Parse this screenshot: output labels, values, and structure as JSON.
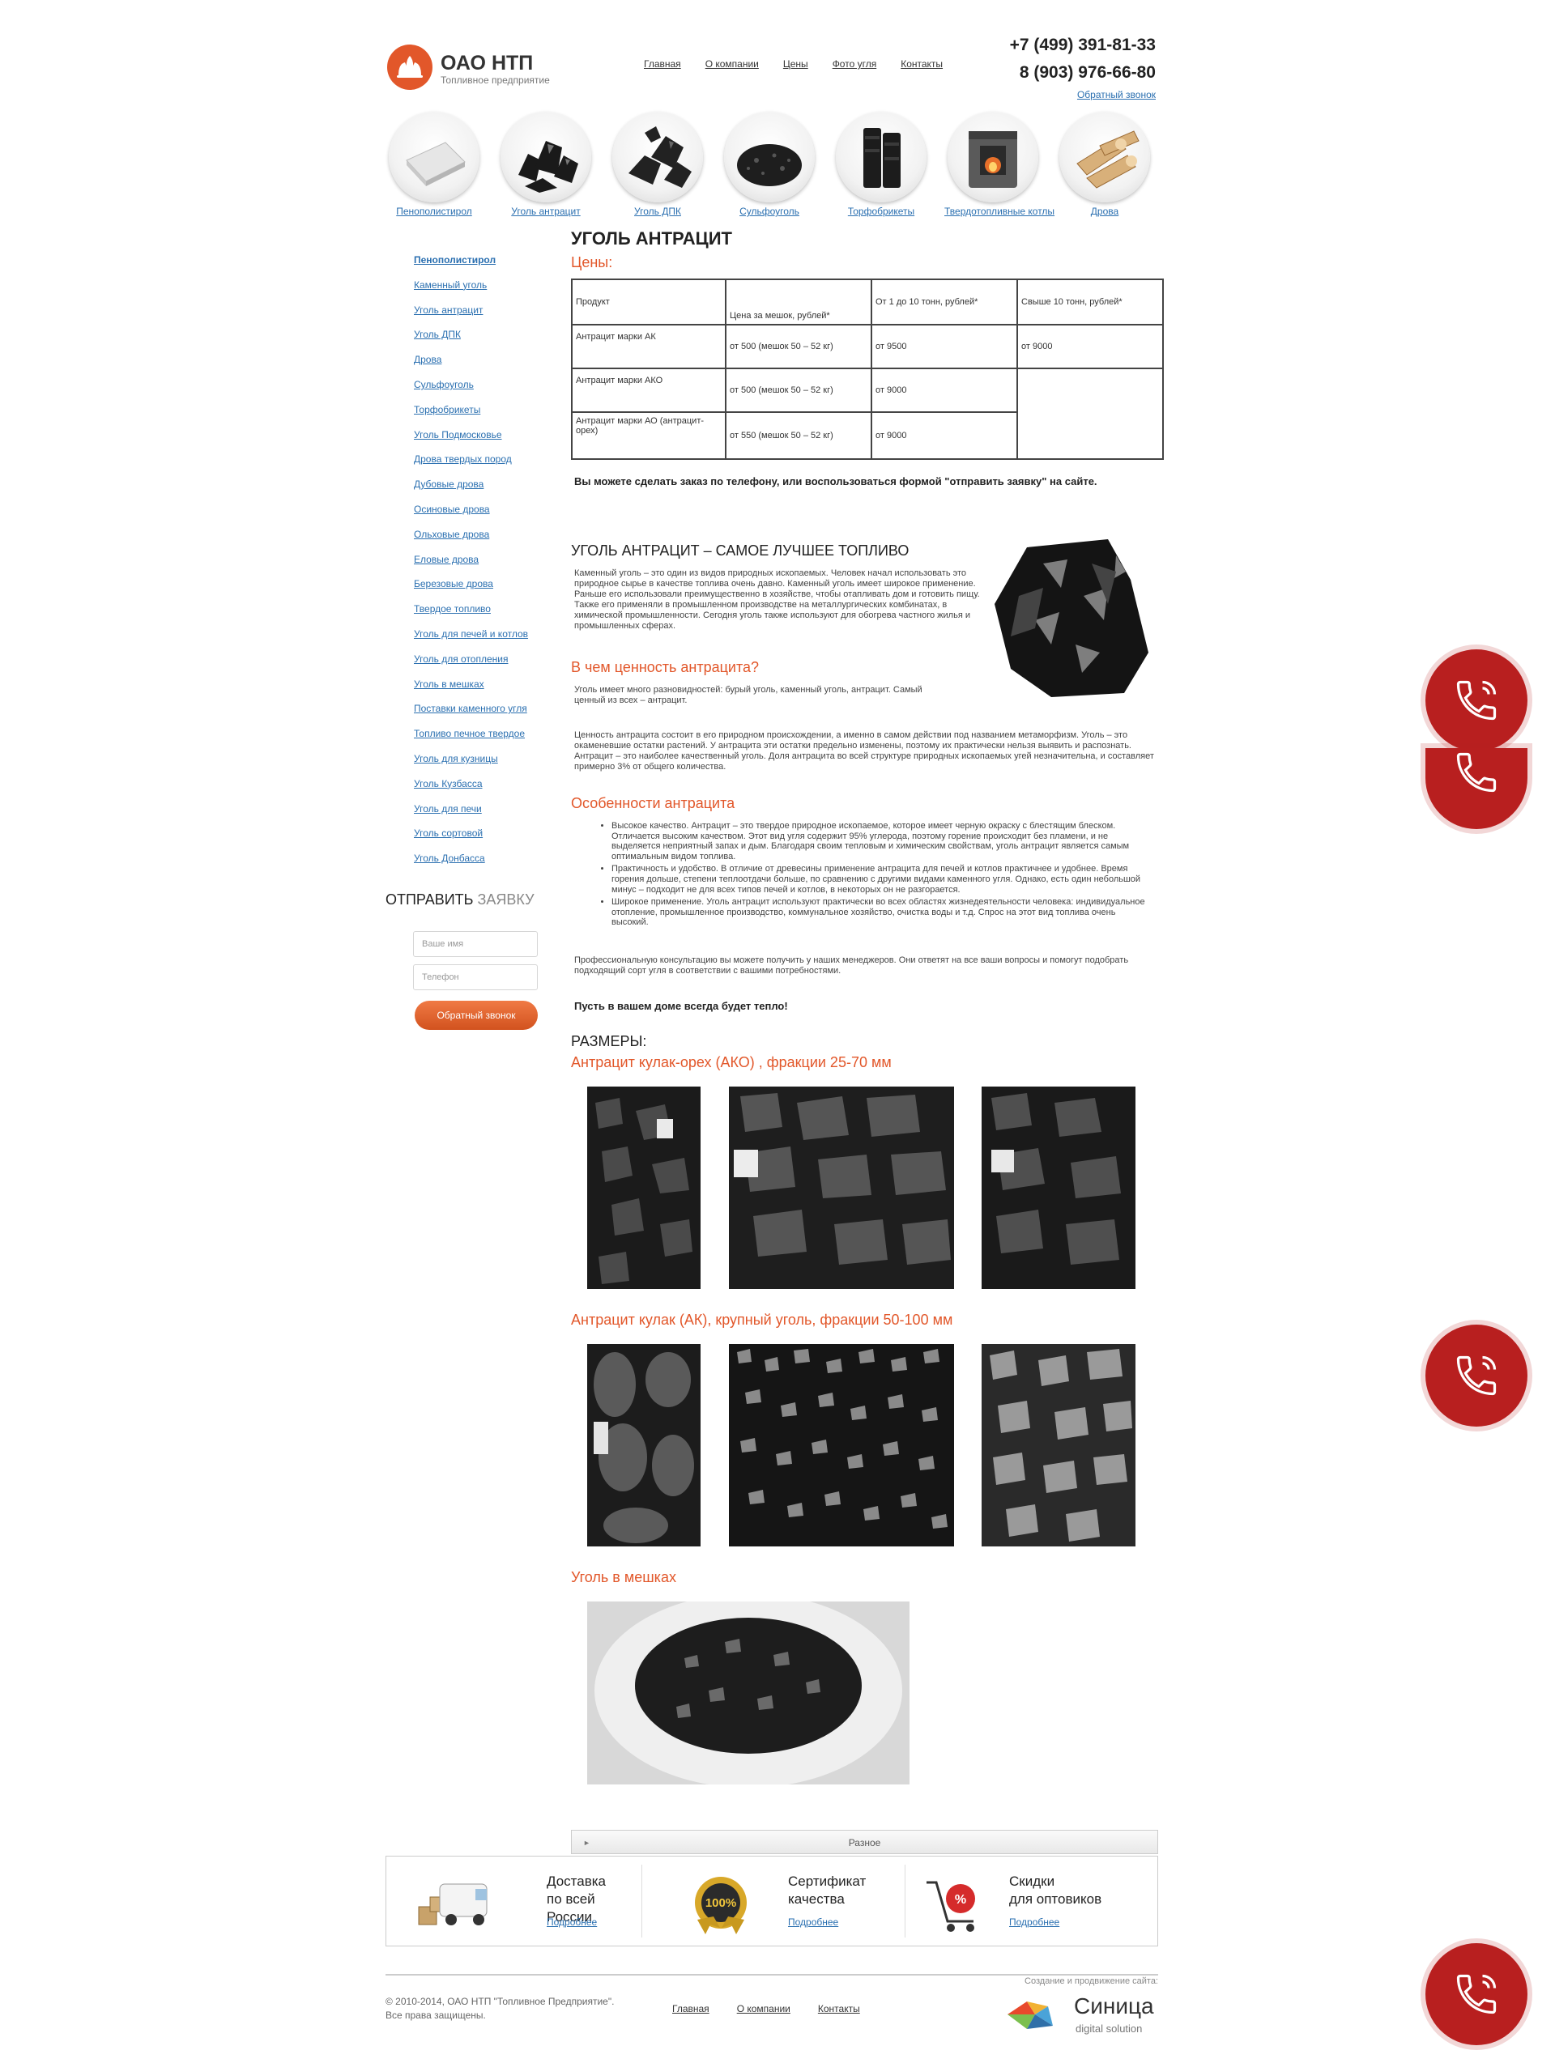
{
  "header": {
    "logo_name": "ОАО НТП",
    "logo_sub": "Топливное предприятие",
    "nav": [
      "Главная",
      "О компании",
      "Цены",
      "Фото угля",
      "Контакты"
    ],
    "phone1": "+7 (499) 391-81-33",
    "phone2": "8 (903) 976-66-80",
    "callback": "Обратный звонок"
  },
  "categories": [
    "Пенополистирол",
    "Уголь антрацит",
    "Уголь ДПК",
    "Сульфоуголь",
    "Торфобрикеты",
    "Твердотопливные котлы",
    "Дрова"
  ],
  "sidebar": {
    "items": [
      "Пенополистирол",
      "Каменный уголь",
      "Уголь антрацит",
      "Уголь ДПК",
      "Дрова",
      "Сульфоуголь",
      "Торфобрикеты",
      "Уголь Подмосковье",
      "Дрова твердых пород",
      "Дубовые дрова",
      "Осиновые дрова",
      "Ольховые дрова",
      "Еловые дрова",
      "Березовые дрова",
      "Твердое топливо",
      "Уголь для печей и котлов",
      "Уголь для отопления",
      "Уголь в мешках",
      "Поставки каменного угля",
      "Топливо печное твердое",
      "Уголь для кузницы",
      "Уголь Кузбасса",
      "Уголь для печи",
      "Уголь сортовой",
      "Уголь Донбасса"
    ],
    "request_title_1": "ОТПРАВИТЬ",
    "request_title_2": "ЗАЯВКУ",
    "name_placeholder": "Ваше имя",
    "phone_placeholder": "Телефон",
    "callback_button": "Обратный звонок"
  },
  "main": {
    "title": "УГОЛЬ АНТРАЦИТ",
    "prices_heading": "Цены:",
    "table_head": [
      "Продукт",
      "Цена за мешок, рублей*",
      "От 1 до 10 тонн, рублей*",
      "Свыше 10 тонн, рублей*"
    ],
    "table_rows": [
      [
        "Антрацит марки АК",
        "от 500   (мешок 50 – 52 кг)",
        "от 9500",
        "от 9000"
      ],
      [
        "Антрацит марки АКО",
        "от 500   (мешок 50 – 52 кг)",
        "от 9000",
        ""
      ],
      [
        "Антрацит марки АО (антрацит-орех)",
        "от 550   (мешок 50 – 52 кг)",
        "от 9000",
        ""
      ]
    ],
    "order_note": "Вы можете сделать заказ по телефону, или воспользоваться формой \"отправить заявку\" на сайте.",
    "best_heading": "УГОЛЬ АНТРАЦИТ – САМОЕ ЛУЧШЕЕ ТОПЛИВО",
    "best_text": "Каменный уголь – это один из видов природных ископаемых. Человек начал использовать это природное сырье в качестве топлива очень давно. Каменный уголь имеет широкое применение. Раньше его использовали преимущественно в хозяйстве, чтобы отапливать дом и готовить пищу. Также его применяли в промышленном производстве на металлургических комбинатах, в химической промышленности. Сегодня уголь также используют для обогрева частного жилья и промышленных сферах.",
    "value_heading": "В чем ценность антрацита?",
    "value_text": "Уголь имеет много разновидностей: бурый уголь, каменный уголь, антрацит. Самый ценный из всех – антрацит.",
    "value_text2": "Ценность антрацита состоит в его природном происхождении, а именно в самом действии под названием метаморфизм. Уголь – это окаменевшие остатки растений. У антрацита эти остатки предельно изменены, поэтому их практически нельзя выявить и распознать. Антрацит – это наиболее качественный уголь. Доля антрацита во всей структуре природных ископаемых угей незначительна, и составляет примерно 3% от общего количества.",
    "features_heading": "Особенности антрацита",
    "features": [
      "Высокое качество. Антрацит – это твердое природное ископаемое, которое имеет черную окраску с блестящим блеском. Отличается высоким качеством. Этот вид угля содержит 95% углерода, поэтому горение происходит без пламени, и не выделяется неприятный запах и дым. Благодаря своим тепловым и химическим свойствам, уголь антрацит является самым оптимальным видом топлива.",
      "Практичность и удобство. В отличие от древесины применение антрацита для печей и котлов практичнее и удобнее. Время горения дольше, степени теплоотдачи больше, по сравнению с другими видами каменного угля. Однако, есть один небольшой минус – подходит не для всех типов печей и котлов, в некоторых он не разгорается.",
      "Широкое применение. Уголь антрацит используют практически во всех областях жизнедеятельности человека: индивидуальное отопление, промышленное производство, коммунальное хозяйство, очистка воды и т.д. Спрос на этот вид топлива очень высокий."
    ],
    "consult": "Профессиональную консультацию вы можете получить у наших менеджеров. Они ответят на все ваши вопросы и помогут подобрать подходящий сорт угля в соответствии с вашими потребностями.",
    "warm": "Пусть в вашем доме всегда будет тепло!",
    "sizes_heading": "РАЗМЕРЫ:",
    "size1": "Антрацит кулак-орех (АКО) , фракции 25-70 мм",
    "size2": "Антрацит кулак (АК), крупный уголь, фракции 50-100 мм",
    "size3": "Уголь в мешках",
    "misc_bar": "Разное"
  },
  "features_box": [
    {
      "line1": "Доставка",
      "line2": "по всей России",
      "more": "Подробнее"
    },
    {
      "line1": "Сертификат",
      "line2": "качества",
      "more": "Подробнее"
    },
    {
      "line1": "Скидки",
      "line2": "для оптовиков",
      "more": "Подробнее"
    }
  ],
  "footer": {
    "copy1": "© 2010-2014, ОАО НТП \"Топливное Предприятие\".",
    "copy2": "Все права защищены.",
    "nav": [
      "Главная",
      "О компании",
      "Контакты"
    ],
    "made": "Создание и продвижение сайта:",
    "brand": "Синица",
    "brand_sub": "digital solution"
  },
  "colors": {
    "accent": "#e2572a",
    "link": "#2a6fb0",
    "call_button": "#b81f1f"
  },
  "icons": {
    "call_button": "phone-icon",
    "badge": "badge-100-icon"
  }
}
